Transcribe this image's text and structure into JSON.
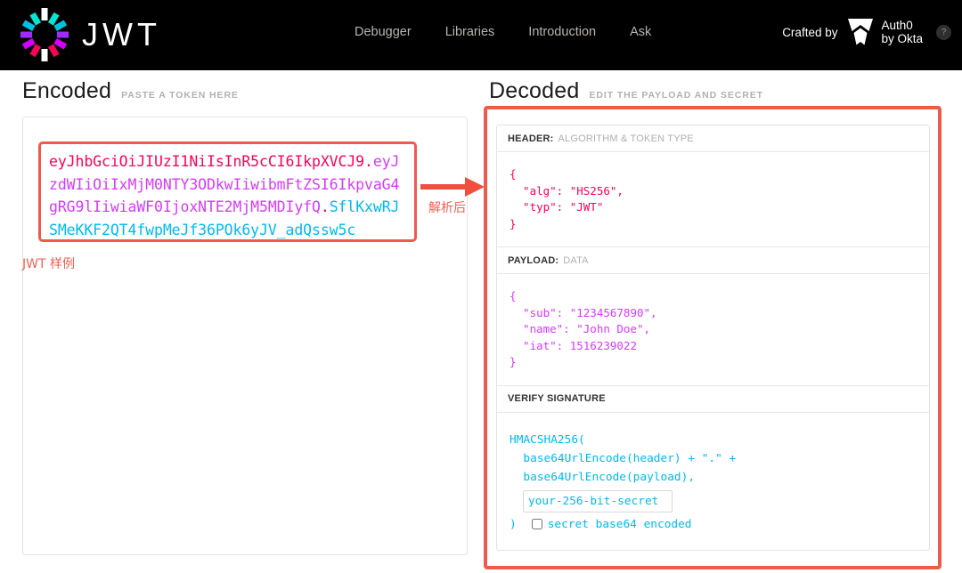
{
  "header": {
    "logo_word": "JWT",
    "logo_icon": "jwt-burst-logo",
    "nav": [
      {
        "label": "Debugger"
      },
      {
        "label": "Libraries"
      },
      {
        "label": "Introduction"
      },
      {
        "label": "Ask"
      }
    ],
    "crafted_by": "Crafted by",
    "auth0_line1": "Auth0",
    "auth0_line2": "by Okta",
    "help_glyph": "?"
  },
  "encoded": {
    "title": "Encoded",
    "subtitle": "PASTE A TOKEN HERE",
    "token_header": "eyJhbGciOiJIUzI1NiIsInR5cCI6IkpXVCJ9",
    "token_dot1": ".",
    "token_payload": "eyJzdWIiOiIxMjM0NTY3ODkwIiwibmFtZSI6IkpvaG4gRG9lIiwiaWF0IjoxNTE2MjM5MDIyfQ",
    "token_dot2": ".",
    "token_signature": "SflKxwRJSMeKKF2QT4fwpMeJf36POk6yJV_adQssw5c",
    "annotation": "JWT 样例"
  },
  "arrow": {
    "label": "解析后"
  },
  "decoded": {
    "title": "Decoded",
    "subtitle": "EDIT THE PAYLOAD AND SECRET",
    "header_label_key": "HEADER:",
    "header_label_value": "ALGORITHM & TOKEN TYPE",
    "header_json": "{\n  \"alg\": \"HS256\",\n  \"typ\": \"JWT\"\n}",
    "payload_label_key": "PAYLOAD:",
    "payload_label_value": "DATA",
    "payload_json": "{\n  \"sub\": \"1234567890\",\n  \"name\": \"John Doe\",\n  \"iat\": 1516239022\n}",
    "signature_label": "VERIFY SIGNATURE",
    "sig_line1": "HMACSHA256(",
    "sig_line2": "  base64UrlEncode(header) + \".\" +",
    "sig_line3": "  base64UrlEncode(payload),",
    "secret_value": "your-256-bit-secret",
    "sig_close_paren": ")",
    "secret_base64_label": "secret base64 encoded"
  },
  "colors": {
    "accent_red": "#f05a4a",
    "header_pink": "#fb015b",
    "payload_purple": "#d63aff",
    "signature_blue": "#00b9f1",
    "topbar_black": "#000000"
  }
}
